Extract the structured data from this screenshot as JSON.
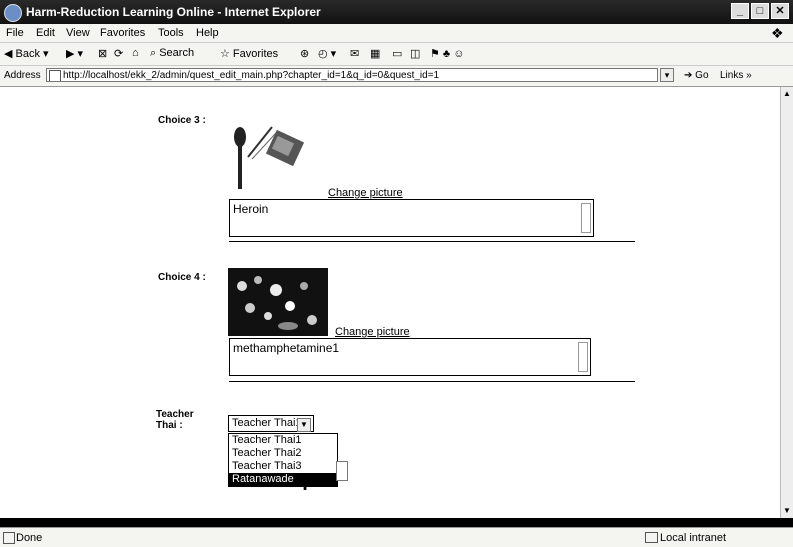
{
  "window": {
    "title": "Harm-Reduction Learning Online - Internet Explorer"
  },
  "menu": [
    "File",
    "Edit",
    "View",
    "Favorites",
    "Tools",
    "Help"
  ],
  "toolbar": {
    "back": "Back",
    "search": "Search",
    "favorites": "Favorites"
  },
  "address": {
    "label": "Address",
    "url": "http://localhost/ekk_2/admin/quest_edit_main.php?chapter_id=1&q_id=0&quest_id=1",
    "go": "Go",
    "links": "Links"
  },
  "form": {
    "choice3": {
      "label": "Choice 3 :",
      "change_picture": "Change picture",
      "value": "Heroin",
      "image_icon": "spoon-syringe-icon"
    },
    "choice4": {
      "label": "Choice 4 :",
      "change_picture": "Change picture",
      "value": "methamphetamine1",
      "image_icon": "pills-photo-icon"
    },
    "teacher": {
      "label_line1": "Teacher",
      "label_line2": "Thai :",
      "selected": "Teacher Thai1",
      "options": [
        "Teacher Thai1",
        "Teacher Thai2",
        "Teacher Thai3",
        "Ratanawade"
      ],
      "highlighted_index": 3
    }
  },
  "status": {
    "text": "Done",
    "zone": "Local intranet"
  }
}
